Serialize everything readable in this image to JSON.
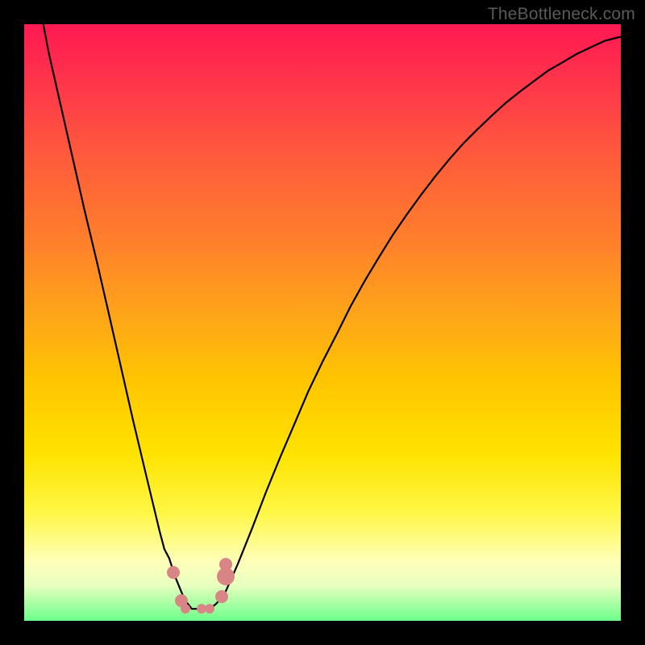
{
  "watermark": "TheBottleneck.com",
  "chart_data": {
    "type": "line",
    "title": "",
    "xlabel": "",
    "ylabel": "",
    "xlim": [
      0,
      100
    ],
    "ylim": [
      0,
      100
    ],
    "x": [
      3.2,
      4.1,
      6.1,
      8.1,
      10.1,
      12.2,
      14.2,
      16.2,
      18.2,
      20.3,
      22.7,
      23.5,
      24.3,
      25.3,
      26.4,
      27.0,
      28.1,
      29.1,
      30.1,
      31.1,
      32.0,
      33.4,
      35.8,
      38.2,
      40.5,
      42.9,
      45.3,
      47.6,
      50.0,
      52.4,
      54.7,
      57.1,
      59.5,
      61.8,
      64.2,
      66.6,
      68.9,
      71.3,
      73.6,
      76.0,
      78.4,
      80.7,
      83.1,
      85.5,
      87.8,
      90.2,
      92.6,
      94.9,
      97.3,
      100.0
    ],
    "y": [
      100.0,
      95.3,
      86.5,
      77.7,
      68.9,
      60.1,
      51.4,
      42.6,
      33.8,
      25.0,
      15.0,
      12.0,
      10.5,
      7.4,
      4.7,
      3.4,
      2.0,
      2.0,
      2.0,
      2.0,
      2.7,
      4.1,
      9.5,
      15.5,
      21.5,
      27.4,
      33.0,
      38.4,
      43.4,
      48.1,
      52.7,
      57.0,
      61.0,
      64.7,
      68.2,
      71.5,
      74.5,
      77.4,
      80.0,
      82.4,
      84.7,
      86.8,
      88.7,
      90.5,
      92.2,
      93.6,
      95.0,
      96.1,
      97.2,
      97.9
    ],
    "markers": [
      {
        "x": 25.0,
        "y": 8.1,
        "r": 8
      },
      {
        "x": 26.4,
        "y": 3.4,
        "r": 8
      },
      {
        "x": 27.0,
        "y": 2.0,
        "r": 6
      },
      {
        "x": 29.7,
        "y": 2.0,
        "r": 6
      },
      {
        "x": 31.1,
        "y": 2.0,
        "r": 6
      },
      {
        "x": 33.1,
        "y": 4.1,
        "r": 8
      },
      {
        "x": 33.8,
        "y": 7.4,
        "r": 11
      },
      {
        "x": 33.8,
        "y": 9.5,
        "r": 8
      }
    ],
    "colors": {
      "curve": "#000000",
      "marker": "#d98585",
      "gradient_top": "#ff1952",
      "gradient_bottom": "#6cff8a"
    }
  }
}
